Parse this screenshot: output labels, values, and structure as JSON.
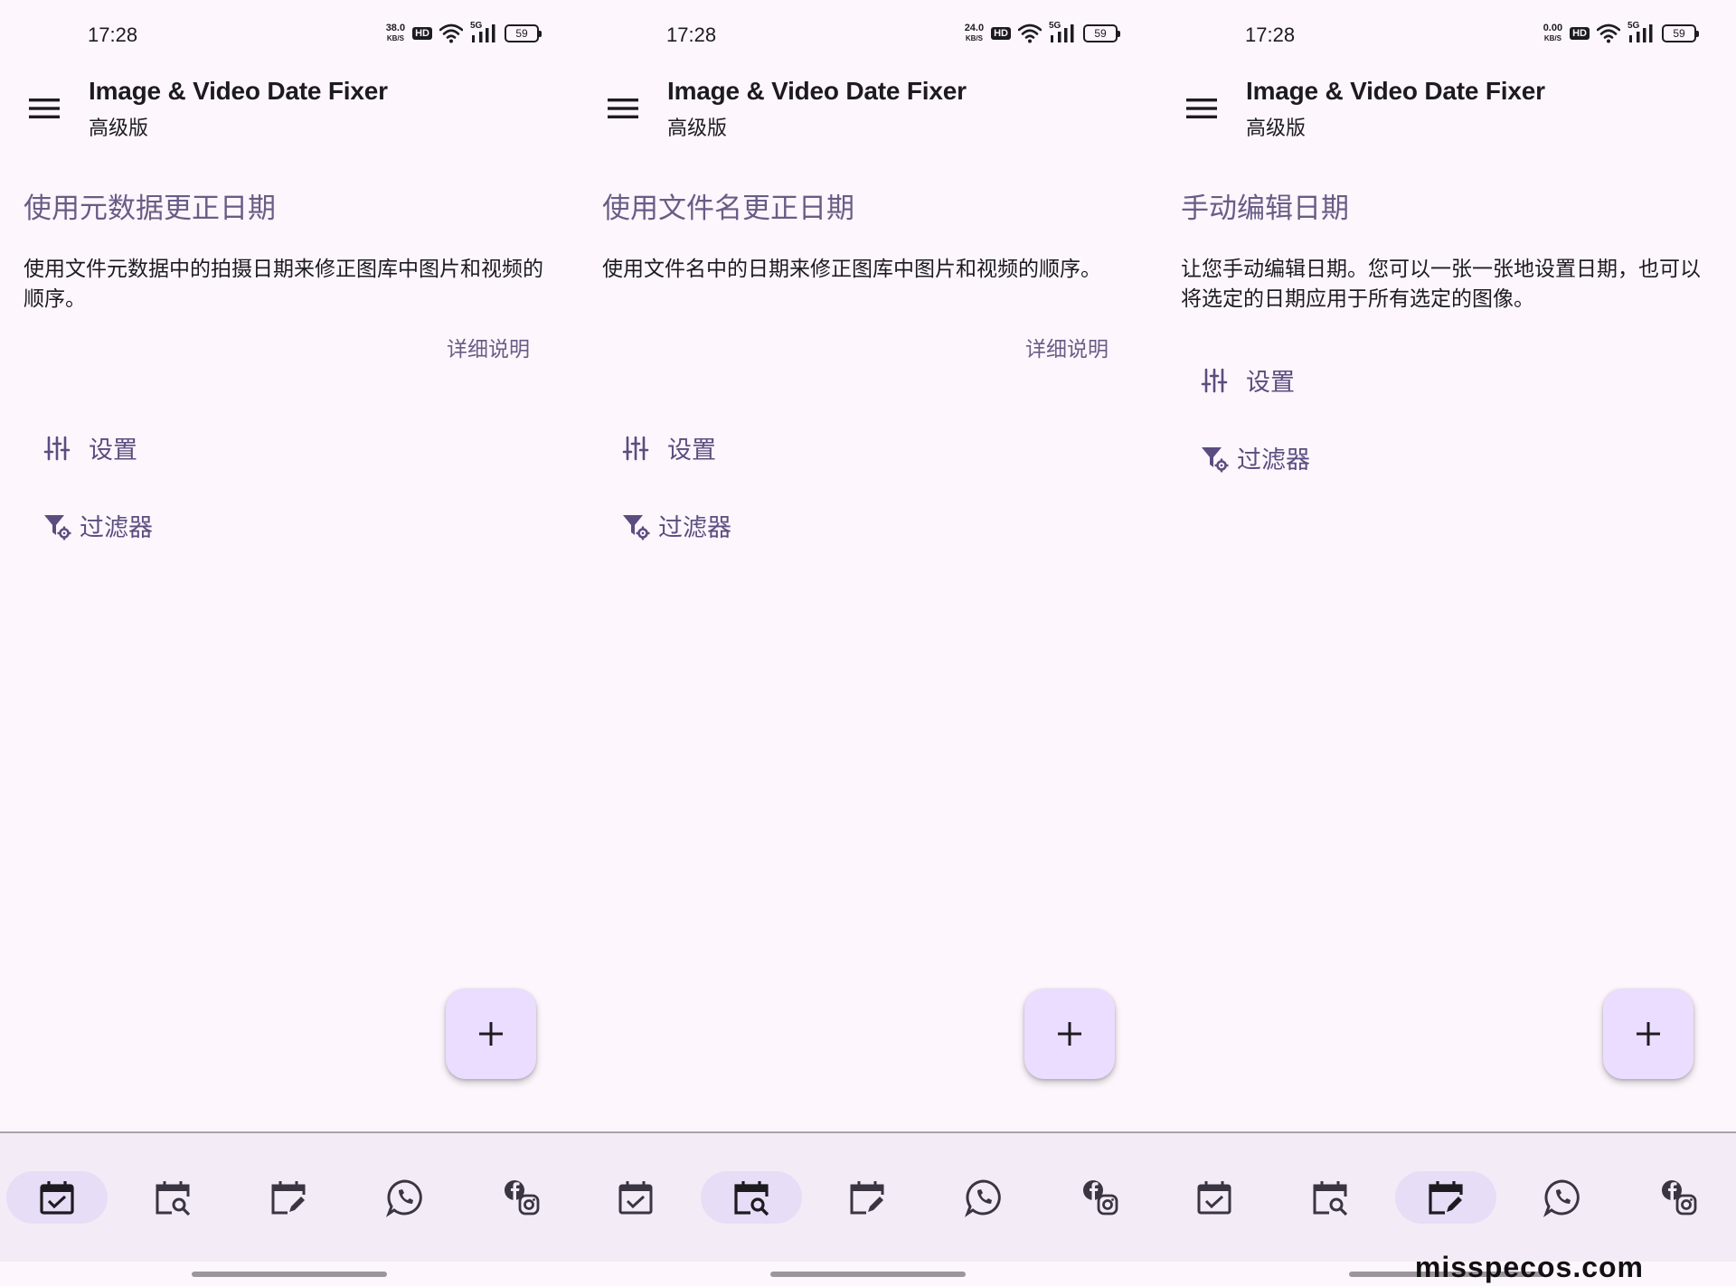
{
  "screens": [
    {
      "status": {
        "time": "17:28",
        "net_speed": "38.0",
        "net_unit": "KB/S",
        "hd": "HD",
        "signal": "5G",
        "battery": "59"
      },
      "app_bar": {
        "title": "Image & Video Date Fixer",
        "subtitle": "高级版"
      },
      "section": {
        "title": "使用元数据更正日期",
        "description": "使用文件元数据中的拍摄日期来修正图库中图片和视频的顺序。",
        "details_link": "详细说明"
      },
      "options": {
        "settings": "设置",
        "filter": "过滤器"
      },
      "fab": {
        "icon": "plus-icon"
      },
      "nav": {
        "active_index": 0,
        "items": [
          "calendar-check-icon",
          "calendar-search-icon",
          "calendar-edit-icon",
          "whatsapp-icon",
          "facebook-instagram-icon"
        ]
      }
    },
    {
      "status": {
        "time": "17:28",
        "net_speed": "24.0",
        "net_unit": "KB/S",
        "hd": "HD",
        "signal": "5G",
        "battery": "59"
      },
      "app_bar": {
        "title": "Image & Video Date Fixer",
        "subtitle": "高级版"
      },
      "section": {
        "title": "使用文件名更正日期",
        "description": "使用文件名中的日期来修正图库中图片和视频的顺序。",
        "details_link": "详细说明"
      },
      "options": {
        "settings": "设置",
        "filter": "过滤器"
      },
      "fab": {
        "icon": "plus-icon"
      },
      "nav": {
        "active_index": 1,
        "items": [
          "calendar-check-icon",
          "calendar-search-icon",
          "calendar-edit-icon",
          "whatsapp-icon",
          "facebook-instagram-icon"
        ]
      }
    },
    {
      "status": {
        "time": "17:28",
        "net_speed": "0.00",
        "net_unit": "KB/S",
        "hd": "HD",
        "signal": "5G",
        "battery": "59"
      },
      "app_bar": {
        "title": "Image & Video Date Fixer",
        "subtitle": "高级版"
      },
      "section": {
        "title": "手动编辑日期",
        "description": "让您手动编辑日期。您可以一张一张地设置日期，也可以将选定的日期应用于所有选定的图像。",
        "details_link": ""
      },
      "options": {
        "settings": "设置",
        "filter": "过滤器"
      },
      "fab": {
        "icon": "plus-icon"
      },
      "nav": {
        "active_index": 2,
        "items": [
          "calendar-check-icon",
          "calendar-search-icon",
          "calendar-edit-icon",
          "whatsapp-icon",
          "facebook-instagram-icon"
        ]
      }
    }
  ],
  "colors": {
    "background": "#fdf7fd",
    "accent": "#6a5c86",
    "fab": "#ebddff",
    "nav_bg": "#f3ecf6",
    "nav_active": "#e7ddf7"
  },
  "watermark": "misspecos.com"
}
